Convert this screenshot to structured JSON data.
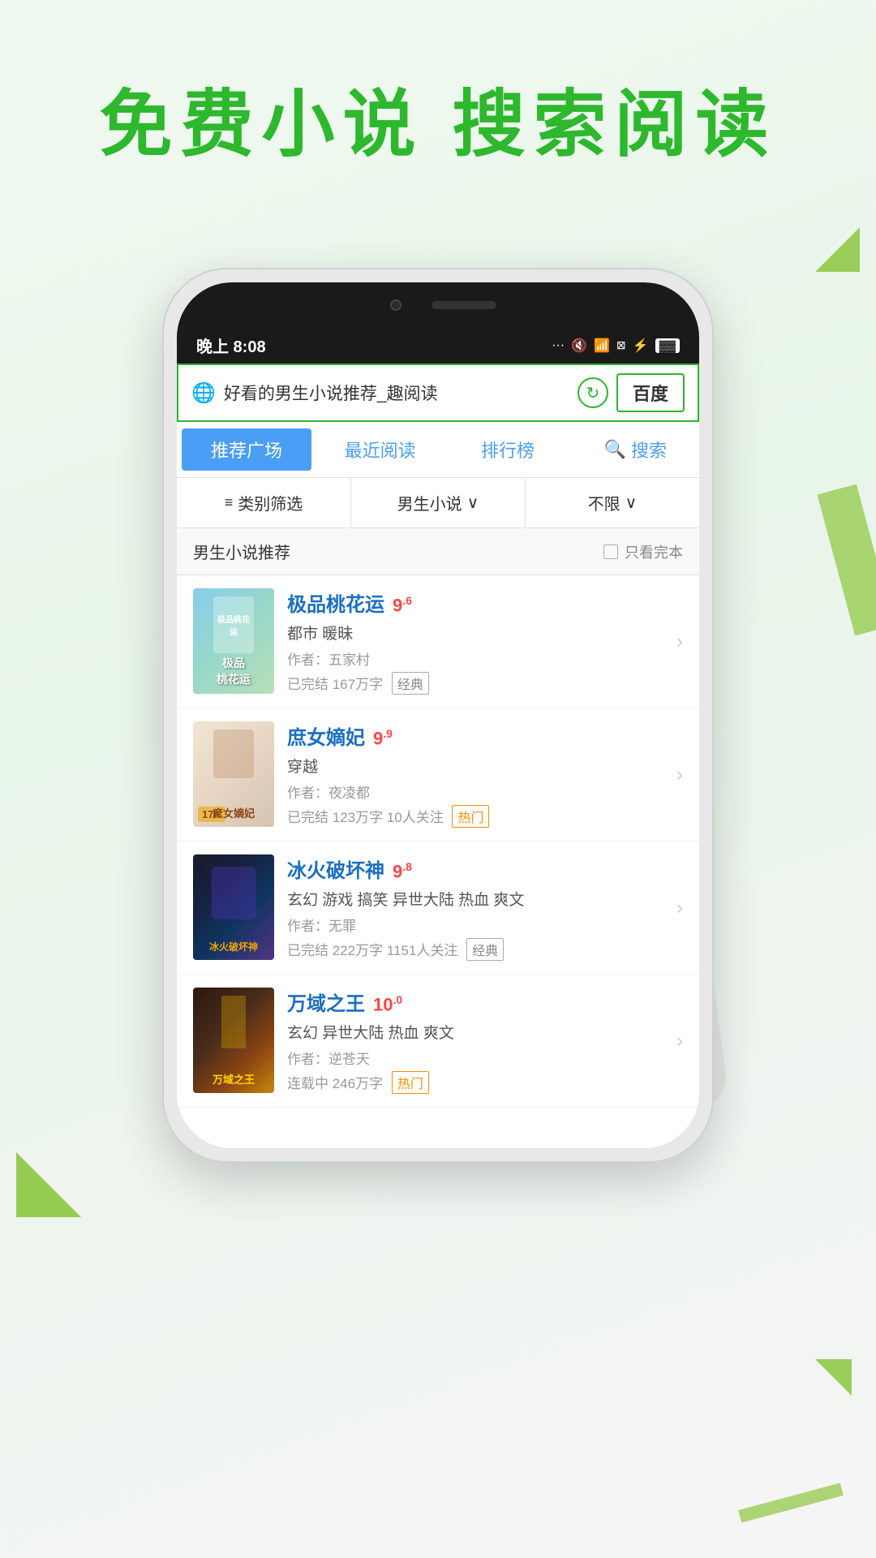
{
  "hero": {
    "title": "免费小说  搜索阅读"
  },
  "status_bar": {
    "time": "晚上 8:08",
    "signal": "···",
    "mute": "🔇",
    "wifi": "📶",
    "battery": "🔋"
  },
  "browser": {
    "url_text": "好看的男生小说推荐_趣阅读",
    "baidu_label": "百度"
  },
  "nav": {
    "tab_recommend": "推荐广场",
    "tab_recent": "最近阅读",
    "tab_rank": "排行榜",
    "tab_search": "搜索"
  },
  "filter": {
    "category_label": "类别筛选",
    "gender_label": "男生小说",
    "gender_suffix": "∨",
    "limit_label": "不限",
    "limit_suffix": "∨"
  },
  "section": {
    "title": "男生小说推荐",
    "only_complete": "只看完本"
  },
  "books": [
    {
      "title": "极品桃花运",
      "rating": "9",
      "rating_decimal": "6",
      "genre": "都市 暖昧",
      "author": "作者：五家村",
      "stats": "已完结 167万字",
      "tag": "经典",
      "tag_type": "classic",
      "cover_class": "cover-1"
    },
    {
      "title": "庶女嫡妃",
      "rating": "9",
      "rating_decimal": "9",
      "genre": "穿越",
      "author": "作者：夜凌都",
      "stats": "已完结 123万字 10人关注",
      "tag": "热门",
      "tag_type": "hot",
      "cover_class": "cover-2",
      "badge": "17K"
    },
    {
      "title": "冰火破坏神",
      "rating": "9",
      "rating_decimal": "8",
      "genre": "玄幻 游戏 搞笑 异世大陆 热血 爽文",
      "author": "作者：无罪",
      "stats": "已完结 222万字 1151人关注",
      "tag": "经典",
      "tag_type": "classic",
      "cover_class": "cover-3"
    },
    {
      "title": "万域之王",
      "rating": "10",
      "rating_decimal": "0",
      "genre": "玄幻 异世大陆 热血 爽文",
      "author": "作者：逆苍天",
      "stats": "连载中 246万字",
      "tag": "热门",
      "tag_type": "hot",
      "cover_class": "cover-4"
    }
  ],
  "colors": {
    "green_accent": "#2cb52c",
    "blue_tab": "#4a9ef5",
    "red_rating": "#ff4444",
    "title_blue": "#1a6fc4"
  }
}
